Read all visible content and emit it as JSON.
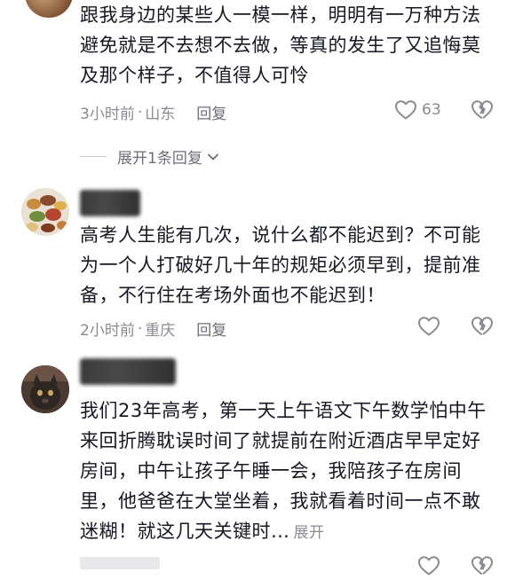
{
  "comments": [
    {
      "lines": [
        "跟我身边的某些人一模一样，明明有一万种方法",
        "避免就是不去想不去做，等真的发生了又追悔莫",
        "及那个样子，不值得人可怜"
      ],
      "time": "3小时前",
      "location": "山东",
      "reply_label": "回复",
      "like_count": "63",
      "expand_label": "展开1条回复"
    },
    {
      "lines": [
        "高考人生能有几次，说什么都不能迟到？不可能",
        "为一个人打破好几十年的规矩必须早到，提前准",
        "备，不行住在考场外面也不能迟到！"
      ],
      "time": "2小时前",
      "location": "重庆",
      "reply_label": "回复"
    },
    {
      "lines": [
        "我们23年高考，第一天上午语文下午数学怕中午",
        "来回折腾耽误时间了就提前在附近酒店早早定好",
        "房间，中午让孩子午睡一会，我陪孩子在房间",
        "里，他爸爸在大堂坐着，我就看着时间一点不敢",
        "迷糊！就这几天关键时…"
      ],
      "expand_inline": "展开"
    }
  ],
  "separator": "·",
  "colors": {
    "text": "#161823",
    "meta": "#8a8b91",
    "icon": "#8a8b91"
  },
  "icons": [
    "heart-outline-icon",
    "broken-heart-icon",
    "chevron-down-icon"
  ]
}
